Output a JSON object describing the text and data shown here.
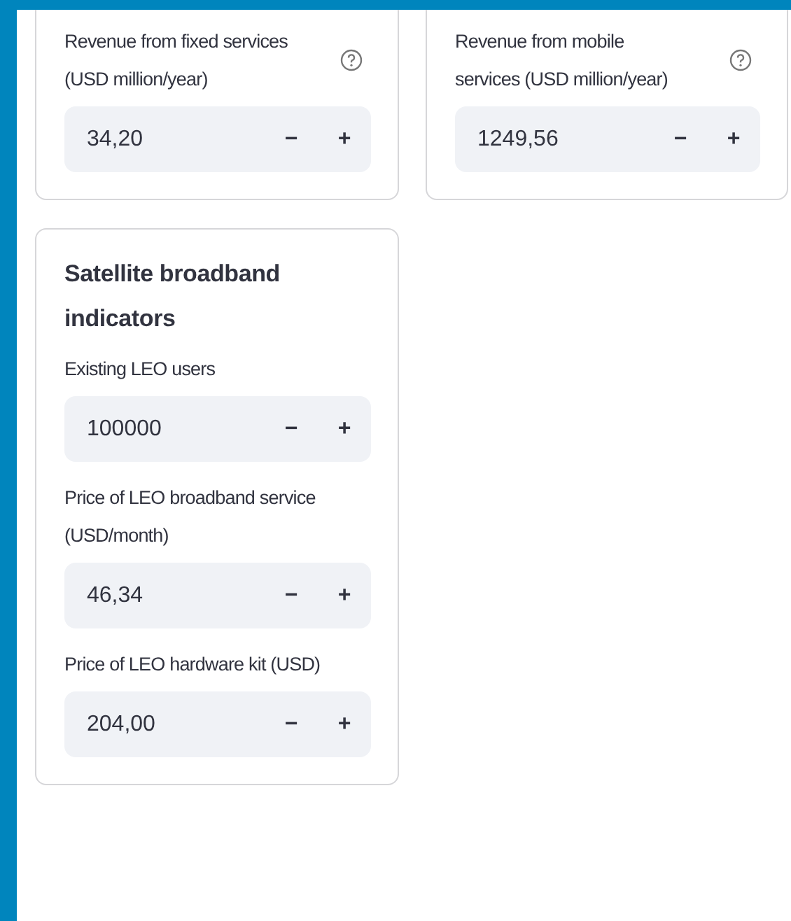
{
  "cards": [
    {
      "fields": [
        {
          "label": "Revenue from fixed services (USD million/year)",
          "help": true,
          "value": "34,20",
          "decrement": "−",
          "increment": "+"
        }
      ]
    },
    {
      "fields": [
        {
          "label": "Revenue from mobile services (USD million/year)",
          "help": true,
          "value": "1249,56",
          "decrement": "−",
          "increment": "+"
        }
      ]
    },
    {
      "title": "Satellite broadband indicators",
      "fields": [
        {
          "label": "Existing LEO users",
          "help": false,
          "value": "100000",
          "decrement": "−",
          "increment": "+"
        },
        {
          "label": "Price of LEO broadband service (USD/month)",
          "help": false,
          "value": "46,34",
          "decrement": "−",
          "increment": "+"
        },
        {
          "label": "Price of LEO hardware kit (USD)",
          "help": false,
          "value": "204,00",
          "decrement": "−",
          "increment": "+"
        }
      ]
    }
  ]
}
